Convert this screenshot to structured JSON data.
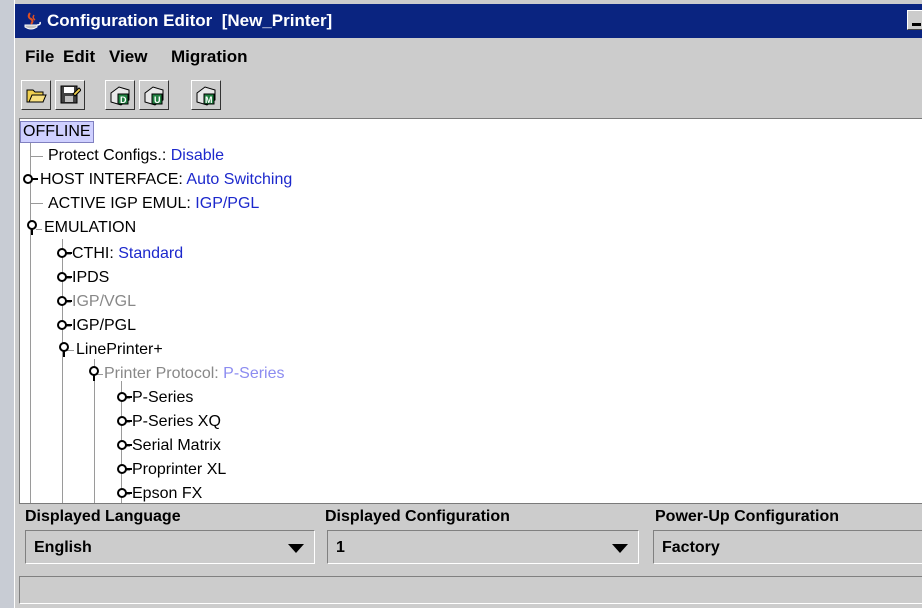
{
  "window": {
    "title": "Configuration Editor  [New_Printer]"
  },
  "menu": {
    "file": "File",
    "edit": "Edit",
    "view": "View",
    "migration": "Migration"
  },
  "toolbar": {
    "icons": [
      "open-folder-icon",
      "save-icon",
      "download-d-icon",
      "upload-u-icon",
      "migrate-m-icon"
    ]
  },
  "tree": {
    "root": "OFFLINE",
    "protect_label": "Protect Configs.: ",
    "protect_value": "Disable",
    "host_label": "HOST INTERFACE: ",
    "host_value": "Auto Switching",
    "igp_label": "ACTIVE IGP EMUL: ",
    "igp_value": "IGP/PGL",
    "emulation": "EMULATION",
    "cthi_label": "CTHI: ",
    "cthi_value": "Standard",
    "ipds": "IPDS",
    "igpvgl": "IGP/VGL",
    "igppgl": "IGP/PGL",
    "lineprinter": "LinePrinter+",
    "protocol_label": "Printer Protocol: ",
    "protocol_value": "P-Series",
    "pseries": "P-Series",
    "pseriesxq": "P-Series XQ",
    "serialmatrix": "Serial Matrix",
    "proprinter": "Proprinter XL",
    "epson": "Epson FX"
  },
  "bottom": {
    "lang_label": "Displayed Language",
    "lang_value": "English",
    "config_label": "Displayed Configuration",
    "config_value": "1",
    "power_label": "Power-Up Configuration",
    "power_value": "Factory"
  },
  "colors": {
    "titlebar": "#0a2480",
    "value_text": "#1c28cc",
    "disabled_text": "#888888"
  }
}
